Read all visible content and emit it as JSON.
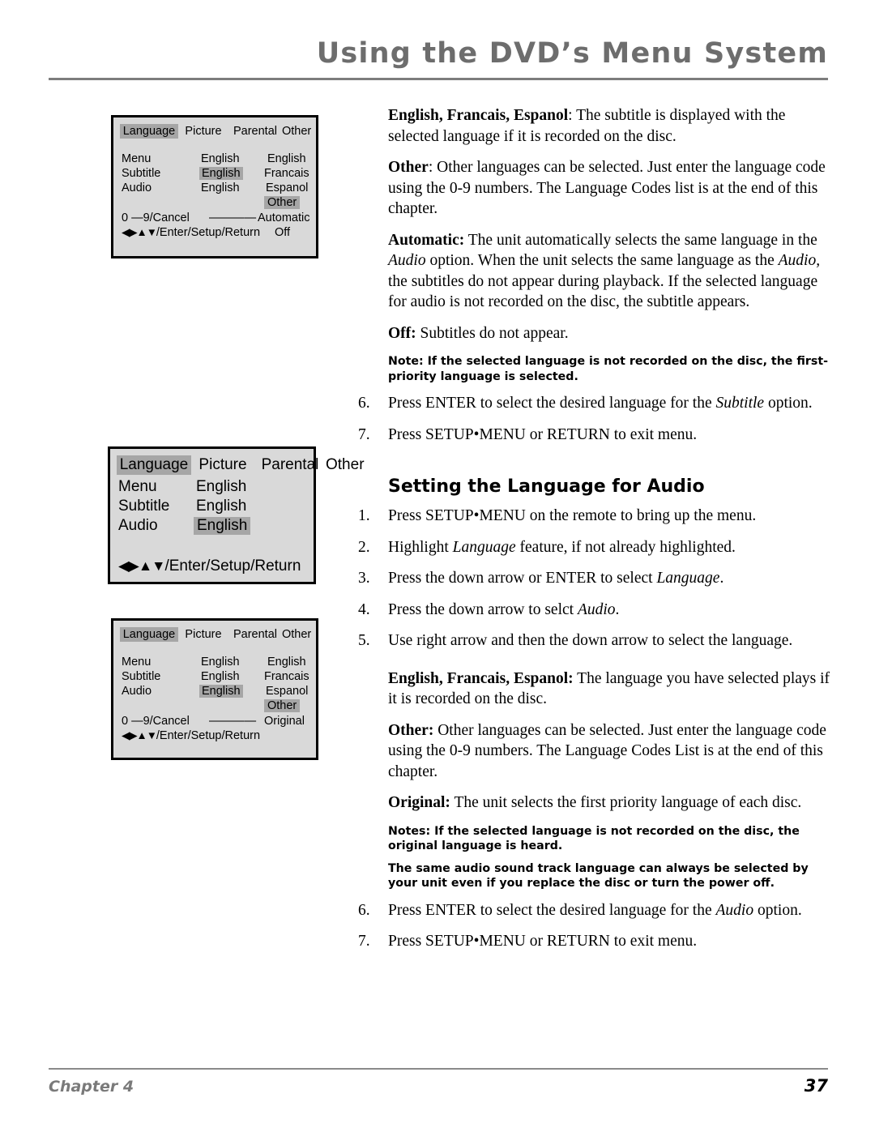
{
  "header": {
    "title": "Using the DVD’s Menu System"
  },
  "footer": {
    "chapter": "Chapter 4",
    "page_number": "37"
  },
  "menus": {
    "subtitle_menu": {
      "tabs": [
        "Language",
        "Picture",
        "Parental",
        "Other"
      ],
      "selected_tab": "Language",
      "rows": [
        {
          "label": "Menu",
          "value": "English",
          "option": "English"
        },
        {
          "label": "Subtitle",
          "value": "English",
          "option": "Francais"
        },
        {
          "label": "Audio",
          "value": "English",
          "option": "Espanol"
        }
      ],
      "highlighted_value_row": "Subtitle",
      "extra_options": [
        "Other",
        "Automatic",
        "Off"
      ],
      "highlighted_option": "Other",
      "numeric_hint": "0 —9/Cancel",
      "code_dashes": "— — — —",
      "nav_arrows": "◀▶▲▼",
      "nav_keys": "/Enter/Setup/Return"
    },
    "audio_simple_menu": {
      "tabs": [
        "Language",
        "Picture",
        "Parental",
        "Other"
      ],
      "selected_tab": "Language",
      "rows": [
        {
          "label": "Menu",
          "value": "English"
        },
        {
          "label": "Subtitle",
          "value": "English"
        },
        {
          "label": "Audio",
          "value": "English"
        }
      ],
      "highlighted_value_row": "Audio",
      "nav_arrows": "◀▶▲▼",
      "nav_keys": "/Enter/Setup/Return"
    },
    "audio_full_menu": {
      "tabs": [
        "Language",
        "Picture",
        "Parental",
        "Other"
      ],
      "selected_tab": "Language",
      "rows": [
        {
          "label": "Menu",
          "value": "English",
          "option": "English"
        },
        {
          "label": "Subtitle",
          "value": "English",
          "option": "Francais"
        },
        {
          "label": "Audio",
          "value": "English",
          "option": "Espanol"
        }
      ],
      "highlighted_value_row": "Audio",
      "extra_options": [
        "Other",
        "Original"
      ],
      "highlighted_option": "Other",
      "numeric_hint": "0 —9/Cancel",
      "code_dashes": "— — — —",
      "nav_arrows": "◀▶▲▼",
      "nav_keys": "/Enter/Setup/Return"
    }
  },
  "subtitle_section": {
    "p1_lead": "English, Francais, Espanol",
    "p1_body": ": The subtitle is displayed with the selected language if it is recorded on the disc.",
    "p2_lead": "Other",
    "p2_body": ": Other languages can be selected. Just enter the language code using the 0-9 numbers. The Language Codes list is at the end of this chapter.",
    "p3_lead": "Automatic:",
    "p3_part1": " The unit automatically selects the same language in the ",
    "p3_em1": "Audio",
    "p3_part2": " option. When the unit selects the same language as the ",
    "p3_em2": "Audio,",
    "p3_part3": " the subtitles do not appear during playback. If the selected language for audio is not recorded on the disc, the subtitle appears.",
    "p4_lead": "Off:",
    "p4_body": " Subtitles do not appear.",
    "note": "Note:  If the selected language is not recorded on the disc, the first-priority language is selected.",
    "step6_num": "6.",
    "step6_part1": "Press ENTER to select the desired language for the ",
    "step6_em": "Subtitle",
    "step6_part2": " option.",
    "step7_num": "7.",
    "step7_text": "Press SETUP•MENU or RETURN to exit menu."
  },
  "audio_section": {
    "heading": "Setting the Language for Audio",
    "step1_num": "1.",
    "step1_text": "Press SETUP•MENU on the remote to bring up the menu.",
    "step2_num": "2.",
    "step2_part1": "Highlight ",
    "step2_em": "Language",
    "step2_part2": " feature, if not already highlighted.",
    "step3_num": "3.",
    "step3_part1": "Press the down arrow or ENTER to select ",
    "step3_em": "Language",
    "step3_part2": ".",
    "step4_num": "4.",
    "step4_part1": "Press the down arrow to selct ",
    "step4_em": "Audio",
    "step4_part2": ".",
    "step5_num": "5.",
    "step5_text": "Use right arrow and then the down arrow to select the language.",
    "p1_lead": "English, Francais, Espanol:",
    "p1_body": " The language you have selected plays if it is recorded on the disc.",
    "p2_lead": "Other:",
    "p2_body": " Other languages can be selected. Just enter the language code using the 0-9 numbers.  The Language Codes List is at the end of this chapter.",
    "p3_lead": "Original:",
    "p3_body": " The unit selects the first priority language of each disc.",
    "note1": "Notes:  If the selected language is not recorded on the disc, the original language is heard.",
    "note2": "The same audio sound track language can always be selected by your unit even if you replace the disc or turn the power off.",
    "step6_num": "6.",
    "step6_part1": "Press ENTER to select the desired language for the ",
    "step6_em": "Audio",
    "step6_part2": " option.",
    "step7_num": "7.",
    "step7_text": "Press SETUP•MENU or RETURN to exit menu."
  },
  "colors": {
    "header_gray": "#6d6d6d",
    "panel_bg": "#d9d9d9",
    "highlight_gray": "#a6a6a6",
    "footer_gray": "#7a7a7a"
  }
}
